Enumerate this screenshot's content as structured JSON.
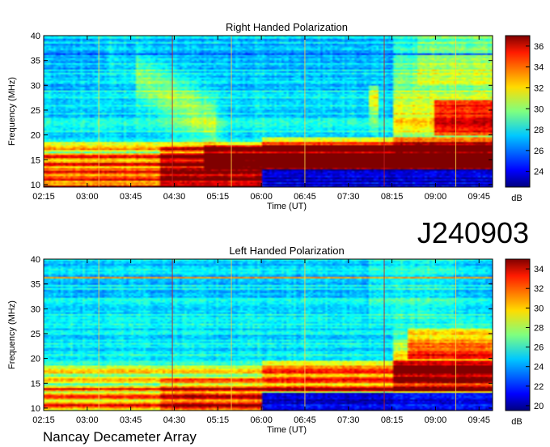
{
  "figure": {
    "observation_id": "J240903",
    "footer_text": "Nancay Decameter Array"
  },
  "chart_data": [
    {
      "type": "heatmap",
      "title": "Right Handed Polarization",
      "xlabel": "Time (UT)",
      "ylabel": "Frequency (MHz)",
      "x_ticks": [
        "02:15",
        "03:00",
        "03:45",
        "04:30",
        "05:15",
        "06:00",
        "06:45",
        "07:30",
        "08:15",
        "09:00",
        "09:45"
      ],
      "x_tick_minutes": [
        135,
        180,
        225,
        270,
        315,
        360,
        405,
        450,
        495,
        540,
        585
      ],
      "xlim_minutes": [
        135,
        599
      ],
      "y_ticks": [
        10,
        15,
        20,
        25,
        30,
        35,
        40
      ],
      "ylim": [
        9.5,
        40
      ],
      "colorbar": {
        "unit": "dB",
        "ticks": [
          24,
          26,
          28,
          30,
          32,
          34,
          36
        ],
        "range": [
          22.5,
          37
        ]
      },
      "features": {
        "band_step_time": "06:00",
        "emission_events": [
          "04:15 arc 17-31 MHz",
          "07:50 burst 17-29 MHz",
          "08:15-09:45 enhancement 18-40 MHz"
        ]
      }
    },
    {
      "type": "heatmap",
      "title": "Left Handed Polarization",
      "xlabel": "Time (UT)",
      "ylabel": "Frequency (MHz)",
      "x_ticks": [
        "02:15",
        "03:00",
        "03:45",
        "04:30",
        "05:15",
        "06:00",
        "06:45",
        "07:30",
        "08:15",
        "09:00",
        "09:45"
      ],
      "x_tick_minutes": [
        135,
        180,
        225,
        270,
        315,
        360,
        405,
        450,
        495,
        540,
        585
      ],
      "xlim_minutes": [
        135,
        599
      ],
      "y_ticks": [
        10,
        15,
        20,
        25,
        30,
        35,
        40
      ],
      "ylim": [
        9.5,
        40
      ],
      "colorbar": {
        "unit": "dB",
        "ticks": [
          20,
          22,
          24,
          26,
          28,
          30,
          32,
          34
        ],
        "range": [
          19.5,
          35
        ]
      },
      "features": {
        "band_step_time": "06:00",
        "emission_events": [
          "08:15-09:45 enhancement 15-26 MHz"
        ]
      }
    }
  ]
}
